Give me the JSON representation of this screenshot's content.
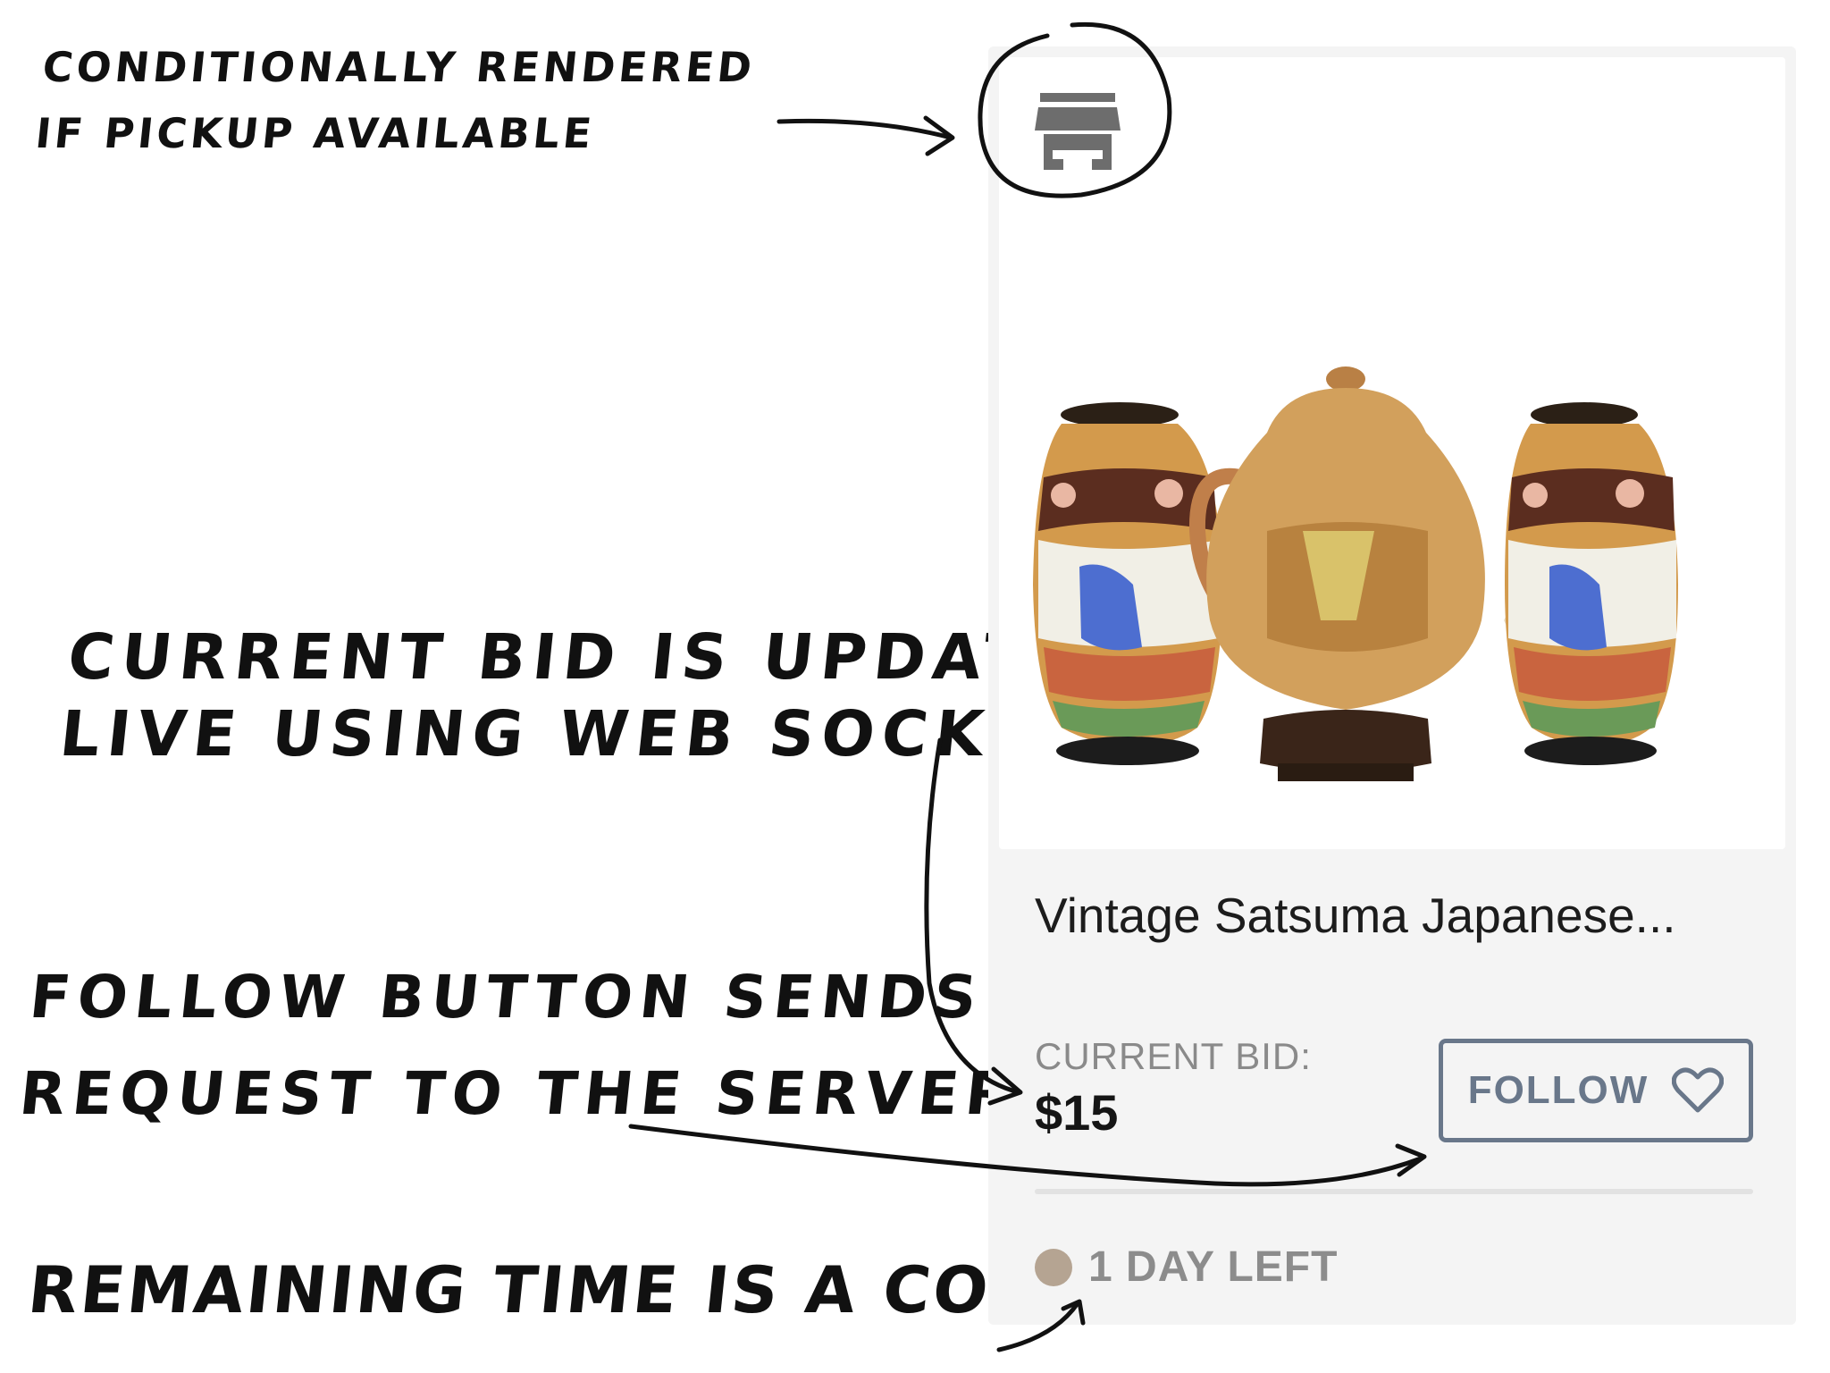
{
  "annotations": {
    "pickup": [
      "Conditionally rendered",
      "if pickup available"
    ],
    "bid": [
      "Current bid is updated",
      "live using web sockets"
    ],
    "follow": [
      "Follow button sends a",
      "request to the server"
    ],
    "time": [
      "Remaining time is a component!"
    ]
  },
  "card": {
    "pickup_icon": "storefront-icon",
    "title": "Vintage Satsuma Japanese...",
    "bid_label": "CURRENT BID:",
    "bid_value": "$15",
    "follow_label": "FOLLOW",
    "follow_icon": "heart-outline-icon",
    "time_left": "1 DAY LEFT"
  },
  "colors": {
    "card_bg": "#f4f4f4",
    "follow_accent": "#69778a",
    "time_dot": "#b5a492",
    "icon_gray": "#6d6d6d"
  }
}
